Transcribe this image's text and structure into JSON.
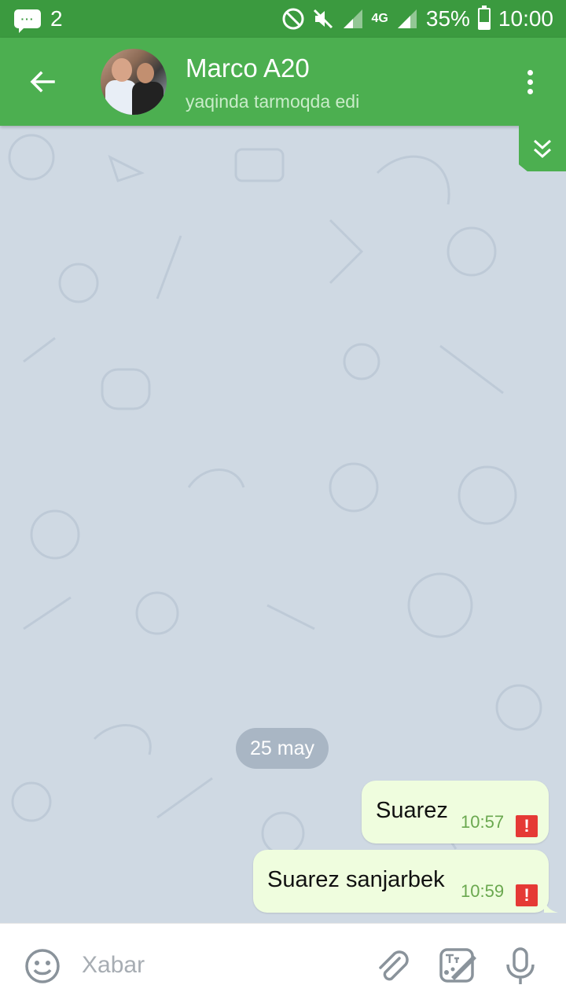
{
  "status_bar": {
    "notification_count": "2",
    "signal_label": "4G",
    "battery": "35%",
    "time": "10:00"
  },
  "header": {
    "contact_name": "Marco A20",
    "status": "yaqinda tarmoqda edi"
  },
  "chat": {
    "date_label": "25 may",
    "messages": [
      {
        "text": "Suarez",
        "time": "10:57",
        "error_glyph": "!"
      },
      {
        "text": "Suarez sanjarbek",
        "time": "10:59",
        "error_glyph": "!"
      }
    ]
  },
  "input": {
    "placeholder": "Xabar"
  },
  "colors": {
    "app_bar": "#4caf50",
    "status_bar": "#3b9a3f",
    "chat_background": "#cfd9e3",
    "outgoing_bubble": "#effdde",
    "time_text": "#6aa84f",
    "error": "#e53935"
  },
  "icons": [
    "message-notification-icon",
    "dnd-icon",
    "mute-icon",
    "signal-icon",
    "battery-icon",
    "back-arrow-icon",
    "more-vert-icon",
    "scroll-down-icon",
    "emoji-icon",
    "attach-icon",
    "sticker-icon",
    "mic-icon",
    "error-icon"
  ]
}
